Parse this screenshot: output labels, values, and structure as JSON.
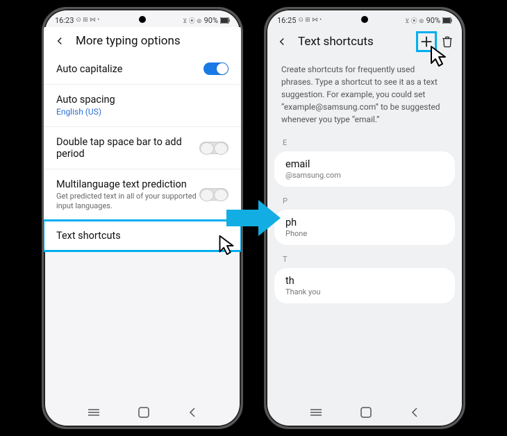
{
  "left": {
    "status": {
      "time": "16:23",
      "icons_left": "⊙ ⊞ ⋈ •",
      "battery": "90%",
      "icons_right": "⊻ ⦿ ⊚"
    },
    "header": {
      "title": "More typing options"
    },
    "rows": {
      "auto_cap": {
        "title": "Auto capitalize"
      },
      "auto_spacing": {
        "title": "Auto spacing",
        "sub": "English (US)"
      },
      "dbl_tap": {
        "title": "Double tap space bar to add period"
      },
      "multilang": {
        "title": "Multilanguage text prediction",
        "sub": "Get predicted text in all of your supported input languages."
      },
      "text_shortcuts": {
        "title": "Text shortcuts"
      }
    }
  },
  "right": {
    "status": {
      "time": "16:25",
      "icons_left": "⊙ ⊞ ⋈ •",
      "battery": "90%",
      "icons_right": "⊻ ⦿ ⊚"
    },
    "header": {
      "title": "Text shortcuts"
    },
    "description": "Create shortcuts for frequently used phrases. Type a shortcut to see it as a text suggestion. For example, you could set “example@samsung.com” to be suggested whenever you type “email.”",
    "sections": {
      "e": {
        "label": "E",
        "title": "email",
        "sub": "@samsung.com"
      },
      "p": {
        "label": "P",
        "title": "ph",
        "sub": "Phone"
      },
      "t": {
        "label": "T",
        "title": "th",
        "sub": "Thank you"
      }
    }
  }
}
